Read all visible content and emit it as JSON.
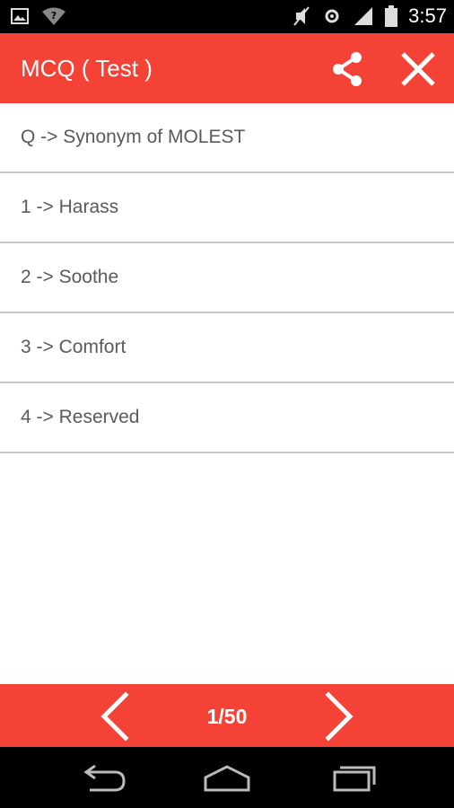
{
  "status_bar": {
    "time": "3:57",
    "icons": [
      "image-icon",
      "wifi-question-icon",
      "mute-icon",
      "sync-icon",
      "signal-icon",
      "battery-icon"
    ]
  },
  "app_bar": {
    "title": "MCQ ( Test )",
    "icons": [
      "share-icon",
      "close-icon"
    ]
  },
  "question": {
    "text": "Q -> Synonym of MOLEST"
  },
  "options": [
    {
      "label": "1 -> Harass"
    },
    {
      "label": "2 -> Soothe"
    },
    {
      "label": "3 -> Comfort"
    },
    {
      "label": "4 -> Reserved"
    }
  ],
  "pager": {
    "indicator": "1/50",
    "icons": [
      "chevron-left-icon",
      "chevron-right-icon"
    ]
  },
  "nav_bar": {
    "icons": [
      "back-icon",
      "home-icon",
      "recent-apps-icon"
    ]
  },
  "colors": {
    "accent": "#f44336",
    "text": "#5a5a5a",
    "divider": "#c8c8c8"
  }
}
